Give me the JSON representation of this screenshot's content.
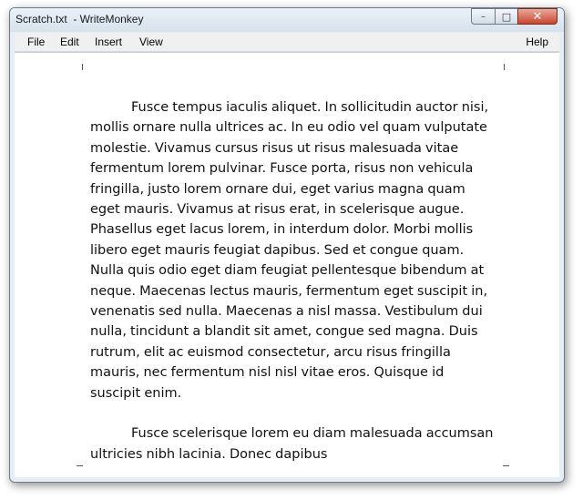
{
  "window": {
    "title": "Scratch.txt  - WriteMonkey",
    "controls": {
      "minimize": "–",
      "maximize": "□",
      "close": "✕"
    }
  },
  "menu": {
    "file": "File",
    "edit": "Edit",
    "insert": "Insert",
    "view": "View",
    "help": "Help"
  },
  "editor": {
    "paragraphs": [
      "Fusce tempus iaculis aliquet. In sollicitudin auctor nisi, mollis ornare nulla ultrices ac. In eu odio vel quam vulputate molestie. Vivamus cursus risus ut risus malesuada vitae fermentum lorem pulvinar. Fusce porta, risus non vehicula fringilla, justo lorem ornare dui, eget varius magna quam eget mauris. Vivamus at risus erat, in scelerisque augue. Phasellus eget lacus lorem, in interdum dolor. Morbi mollis libero eget mauris feugiat dapibus. Sed et congue quam. Nulla quis odio eget diam feugiat pellentesque bibendum at neque. Maecenas lectus mauris, fermentum eget suscipit in, venenatis sed nulla. Maecenas a nisl massa. Vestibulum dui nulla, tincidunt a blandit sit amet, congue sed magna. Duis rutrum, elit ac euismod consectetur, arcu risus fringilla mauris, nec fermentum nisl nisl vitae eros. Quisque id suscipit enim.",
      "Fusce scelerisque lorem eu diam malesuada accumsan ultricies nibh lacinia. Donec dapibus"
    ]
  },
  "colors": {
    "window_frame": "#e6edf5",
    "close_button": "#c8462c",
    "text": "#111111",
    "page": "#ffffff"
  }
}
